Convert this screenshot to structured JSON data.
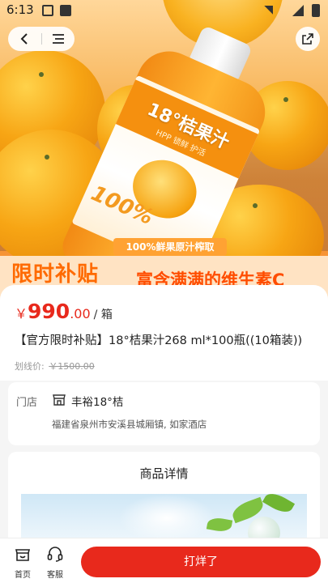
{
  "status_bar": {
    "time": "6:13"
  },
  "hero": {
    "bottle_brand": "18°桔果汁",
    "bottle_sub": "HPP 锁鲜 护活",
    "bottle_big": "100%",
    "tag": "100%鲜果原汁榨取",
    "left_title": "限时补贴",
    "right_title": "富含满满的维生素C"
  },
  "product": {
    "currency": "￥",
    "price": "990",
    "price_decimal": ".00",
    "unit": "/ 箱",
    "title": "【官方限时补贴】18°桔果汁268 ml*100瓶((10箱装))",
    "original_label": "划线价:",
    "original_price": "￥1500.00"
  },
  "store": {
    "label": "门店",
    "name": "丰裕18°桔",
    "address": "福建省泉州市安溪县城厢镇, 如家酒店"
  },
  "detail": {
    "title": "商品详情"
  },
  "bottom_bar": {
    "home_label": "首页",
    "service_label": "客服",
    "cta_label": "打烊了"
  },
  "colors": {
    "accent": "#e8291c",
    "orange": "#ff6a00"
  },
  "icons": [
    "back-icon",
    "menu-icon",
    "share-icon",
    "store-icon",
    "home-icon",
    "headset-icon"
  ]
}
